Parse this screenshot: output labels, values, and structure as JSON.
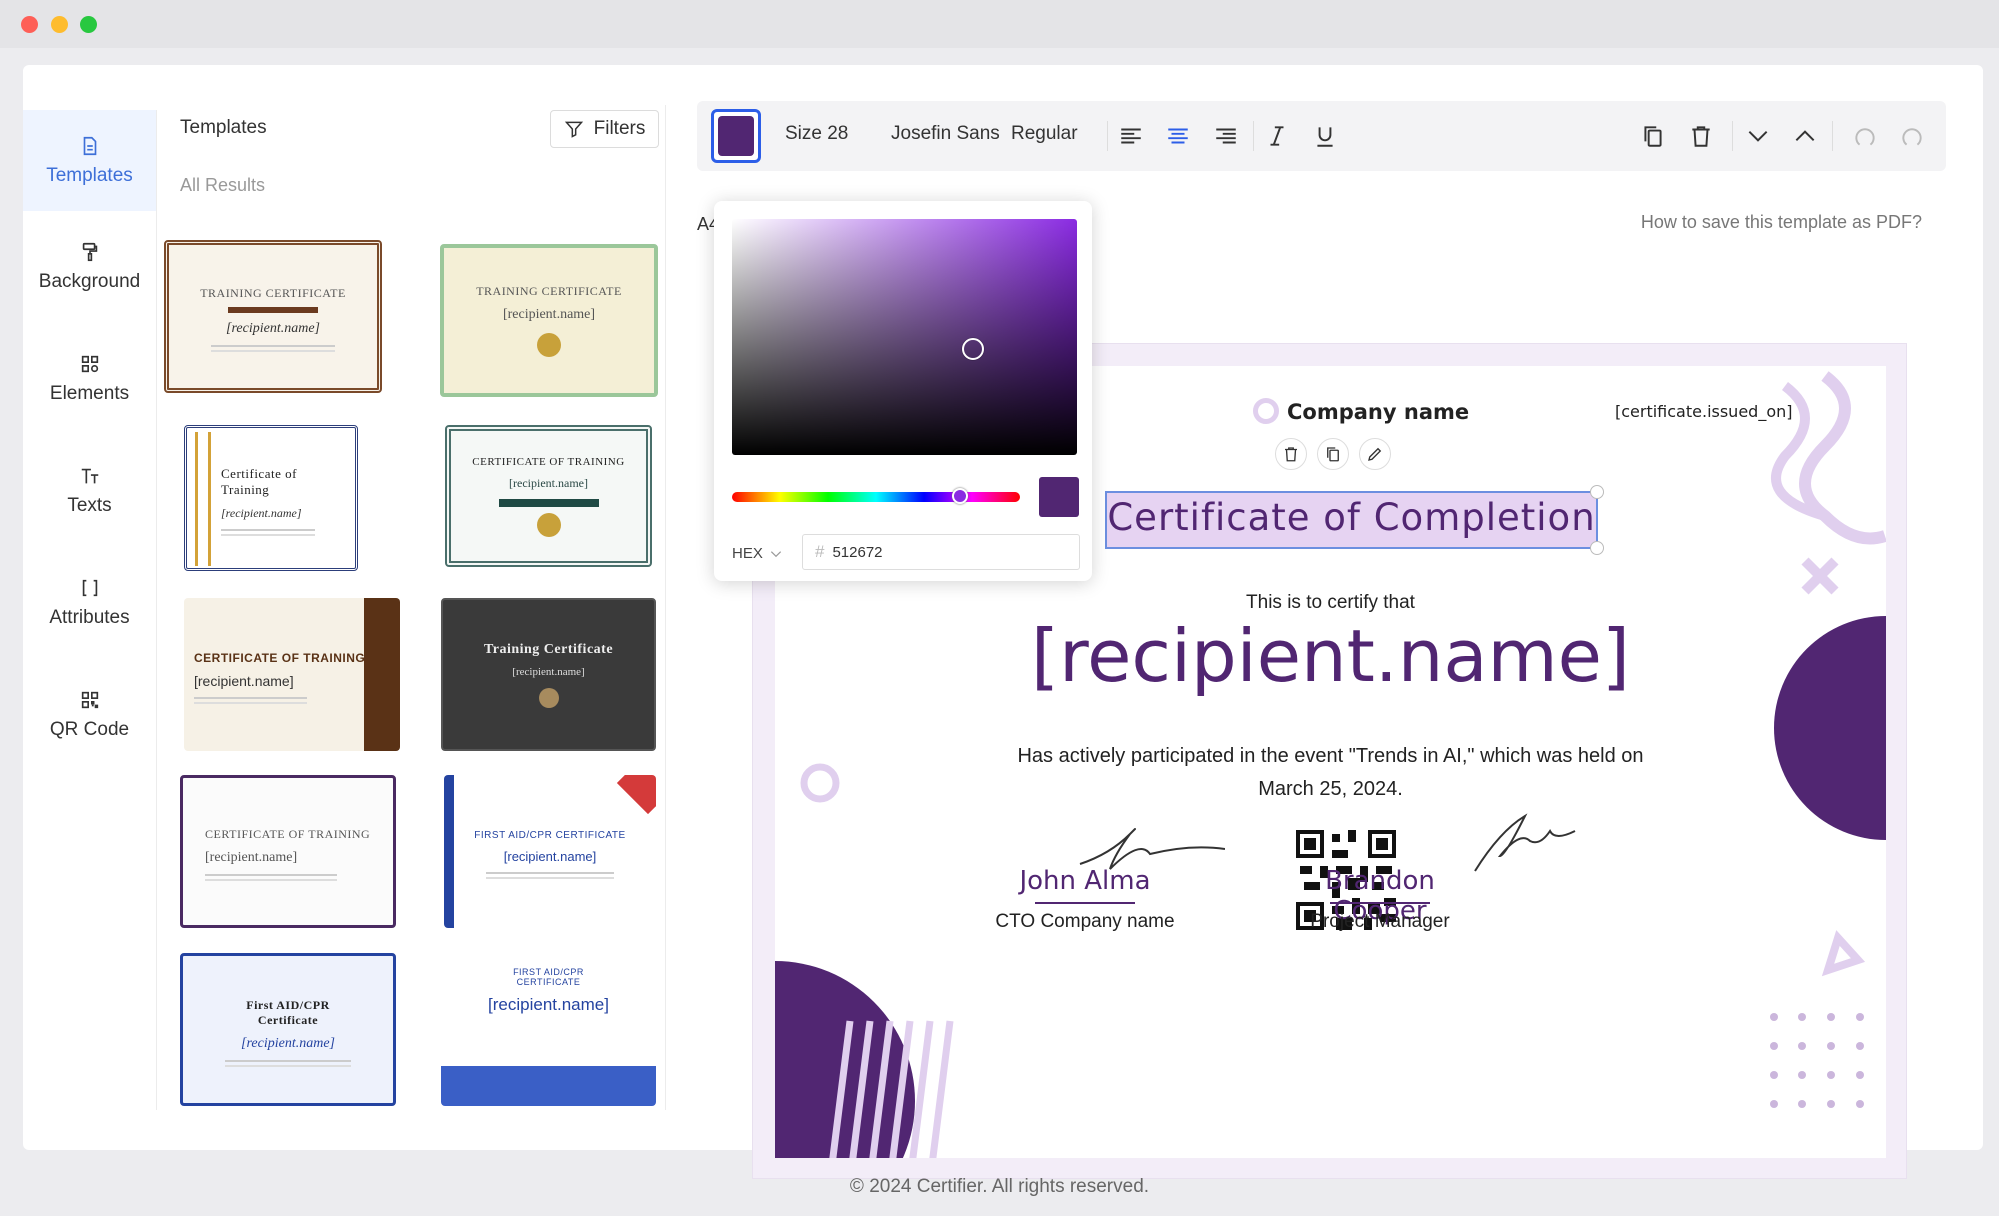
{
  "sidebar": {
    "items": [
      {
        "label": "Templates"
      },
      {
        "label": "Background"
      },
      {
        "label": "Elements"
      },
      {
        "label": "Texts"
      },
      {
        "label": "Attributes"
      },
      {
        "label": "QR Code"
      }
    ]
  },
  "templates": {
    "title": "Templates",
    "filters_label": "Filters",
    "results_label": "All Results",
    "cards": [
      {
        "title": "TRAINING CERTIFICATE",
        "name": "[recipient.name]"
      },
      {
        "title": "TRAINING CERTIFICATE",
        "name": "[recipient.name]"
      },
      {
        "title": "Certificate of Training",
        "name": "[recipient.name]"
      },
      {
        "title": "CERTIFICATE OF TRAINING",
        "name": "[recipient.name]"
      },
      {
        "title": "CERTIFICATE OF TRAINING",
        "name": "[recipient.name]"
      },
      {
        "title": "Training Certificate",
        "name": "[recipient.name]"
      },
      {
        "title": "CERTIFICATE OF TRAINING",
        "name": "[recipient.name]"
      },
      {
        "title": "FIRST AID/CPR CERTIFICATE",
        "name": "[recipient.name]"
      },
      {
        "title": "First AID/CPR Certificate",
        "name": "[recipient.name]"
      },
      {
        "title": "FIRST AID/CPR CERTIFICATE",
        "name": "[recipient.name]"
      }
    ]
  },
  "toolbar": {
    "color": "#512672",
    "size_label": "Size 28",
    "font_label": "Josefin Sans",
    "weight_label": "Regular"
  },
  "editor": {
    "paper_label": "A4",
    "help_link": "How to save this template as PDF?"
  },
  "color_picker": {
    "mode_label": "HEX",
    "hex_value": "512672",
    "hue_fraction": 0.79
  },
  "certificate": {
    "company": "Company name",
    "issued_on": "[certificate.issued_on]",
    "title": "Certificate of Completion",
    "certify_text": "This is to certify that",
    "recipient": "[recipient.name]",
    "description": "Has actively participated in the event \"Trends in AI,\" which was held on",
    "date_line": "March 25, 2024.",
    "signer1_name": "John Alma",
    "signer1_role": "CTO Company name",
    "signer2_name": "Brandon Cooper",
    "signer2_role": "Project Manager",
    "accent_color": "#512672"
  },
  "footer": {
    "text": "© 2024 Certifier. All rights reserved."
  }
}
